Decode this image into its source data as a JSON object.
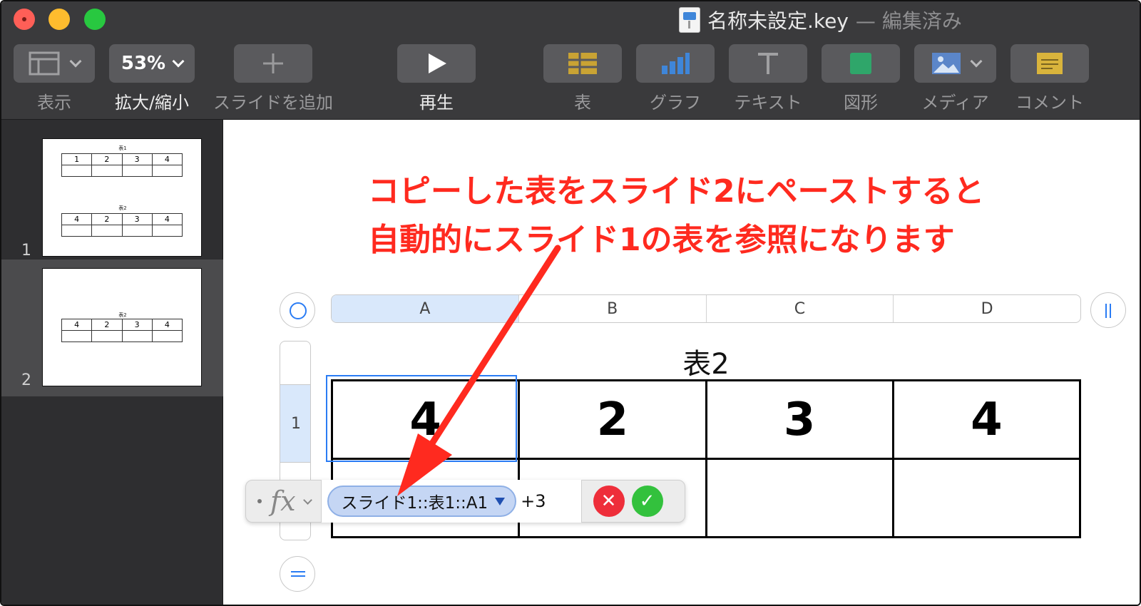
{
  "window": {
    "title": "名称未設定.key",
    "separator": "—",
    "status": "編集済み"
  },
  "toolbar": {
    "view_label": "表示",
    "zoom_value": "53%",
    "zoom_label": "拡大/縮小",
    "add_slide_label": "スライドを追加",
    "play_label": "再生",
    "table_label": "表",
    "chart_label": "グラフ",
    "text_label": "テキスト",
    "shape_label": "図形",
    "media_label": "メディア",
    "comment_label": "コメント"
  },
  "sidebar": {
    "slides": [
      {
        "number": "1",
        "tables": [
          {
            "caption": "表1",
            "row1": [
              "1",
              "2",
              "3",
              "4"
            ]
          },
          {
            "caption": "表2",
            "row1": [
              "4",
              "2",
              "3",
              "4"
            ]
          }
        ]
      },
      {
        "number": "2",
        "tables": [
          {
            "caption": "表2",
            "row1": [
              "4",
              "2",
              "3",
              "4"
            ]
          }
        ]
      }
    ]
  },
  "annotation": {
    "line1": "コピーした表をスライド2にペーストすると",
    "line2": "自動的にスライド1の表を参照になります"
  },
  "table": {
    "title": "表2",
    "columns": [
      "A",
      "B",
      "C",
      "D"
    ],
    "row_numbers": [
      "1"
    ],
    "rows": [
      [
        "4",
        "2",
        "3",
        "4"
      ],
      [
        "",
        "",
        "",
        ""
      ]
    ]
  },
  "formula": {
    "label": "fx",
    "reference": "スライド1::表1::A1",
    "tail": "+3",
    "cancel_glyph": "✕",
    "accept_glyph": "✓"
  },
  "colors": {
    "annotation": "#ff2a1f",
    "selection": "#2a7cf4",
    "toolbar": "#3a3a3c"
  }
}
